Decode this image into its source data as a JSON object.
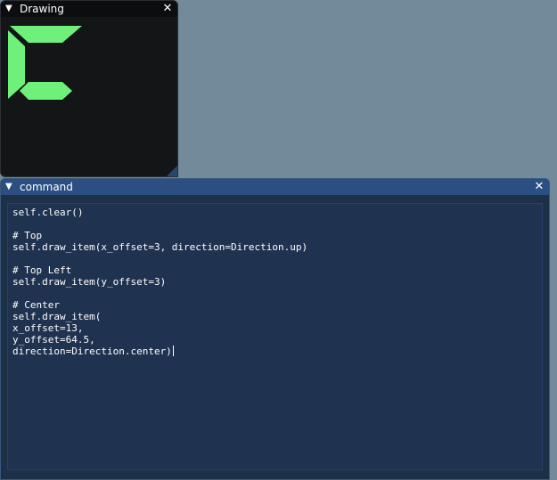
{
  "drawing_window": {
    "title": "Drawing",
    "collapse_glyph": "▼",
    "close_glyph": "✕",
    "shape_color": "#6ef07a"
  },
  "command_window": {
    "title": "command",
    "collapse_glyph": "▼",
    "close_glyph": "✕",
    "code_lines": [
      "self.clear()",
      "",
      "# Top",
      "self.draw_item(x_offset=3, direction=Direction.up)",
      "",
      "# Top Left",
      "self.draw_item(y_offset=3)",
      "",
      "# Center",
      "self.draw_item(",
      "x_offset=13,",
      "y_offset=64.5,",
      "direction=Direction.center)"
    ]
  },
  "colors": {
    "background": "#728a99",
    "command_title_bg": "#2b4f82",
    "editor_bg": "#1f3250"
  }
}
